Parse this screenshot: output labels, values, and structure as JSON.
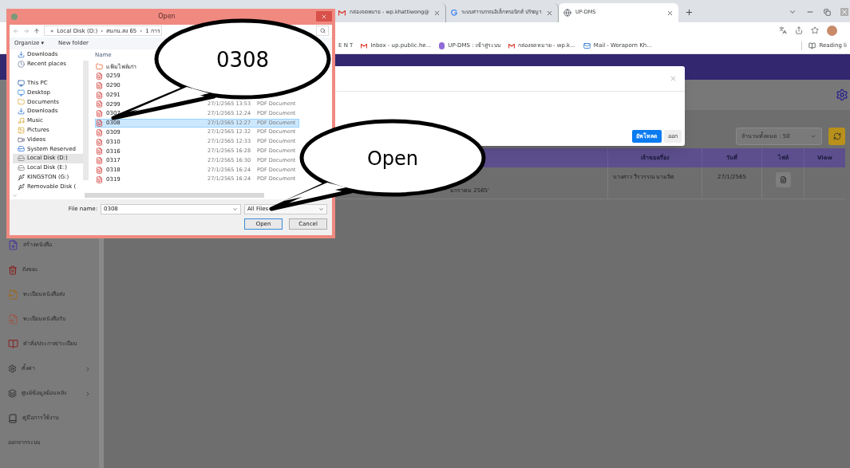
{
  "browser": {
    "tabs": [
      {
        "title": "กล่องจดหมาย - wp.khattiwong@",
        "kind": "gmail",
        "selected": false
      },
      {
        "title": "ระบบสารบรรณอิเล็กทรอนิกส์ ปรัชญา",
        "kind": "google",
        "selected": false
      },
      {
        "title": "UP-DMS",
        "kind": "globe",
        "selected": true
      }
    ],
    "bookmarks": [
      {
        "label": "E N T",
        "kind": "none"
      },
      {
        "label": "Inbox - up.public.he...",
        "kind": "gmail"
      },
      {
        "label": "UP-DMS : เข้าสู่ระบบ",
        "kind": "badge"
      },
      {
        "label": "กล่องจดหมาย - wp.k...",
        "kind": "gmail"
      },
      {
        "label": "Mail - Woraporn Kh...",
        "kind": "outlook"
      }
    ],
    "reading_list": "Reading li"
  },
  "sidebar": {
    "items": [
      {
        "label": "สร้างหนังสือ",
        "kind": "create",
        "submenu": false
      },
      {
        "label": "ถังขยะ",
        "kind": "trash",
        "submenu": false
      },
      {
        "label": "ทะเบียนหนังสือส่ง",
        "kind": "send",
        "submenu": false
      },
      {
        "label": "ทะเบียนหนังสือรับ",
        "kind": "receive",
        "submenu": false
      },
      {
        "label": "คำสั่ง/ประกาศ/ระเบียบ",
        "kind": "book",
        "submenu": false
      },
      {
        "label": "ตั้งค่า",
        "kind": "gear",
        "submenu": true
      },
      {
        "label": "ศูนย์ข้อมูลย้อนหลัง",
        "kind": "layers",
        "submenu": true
      },
      {
        "label": "คู่มือการใช้งาน",
        "kind": "manual",
        "submenu": false
      },
      {
        "label": "ออกจากระบบ",
        "kind": "none",
        "submenu": false
      }
    ]
  },
  "upload_modal": {
    "buttons": [
      {
        "label": "อัพโหลด",
        "kind": "primary"
      },
      {
        "label": "ออก",
        "kind": "secondary"
      }
    ]
  },
  "count_select": {
    "value": "จำนวนทั้งหมด : 50"
  },
  "table": {
    "columns": [
      "เจ้าของเรื่อง",
      "วันที่",
      "ไฟล์",
      "View"
    ],
    "rows": [
      {
        "subject": "มกราคม 2565'",
        "owner": "นางสาว วีรวรรณ นามจิต",
        "date": "27/1/2565"
      }
    ]
  },
  "open_dialog": {
    "title": "Open",
    "breadcrumb": [
      "«",
      "Local Disk (D:)",
      "›",
      "สนกน.สง 65",
      "›",
      "1 การ"
    ],
    "toolbar": [
      "Organize ▾",
      "New folder"
    ],
    "nav": [
      {
        "label": "Downloads",
        "kind": "downloads",
        "selected": false
      },
      {
        "label": "Recent places",
        "kind": "recent",
        "selected": false
      },
      {
        "label": "This PC",
        "kind": "pc",
        "selected": false
      },
      {
        "label": "Desktop",
        "kind": "desktop",
        "selected": false
      },
      {
        "label": "Documents",
        "kind": "documents",
        "selected": false
      },
      {
        "label": "Downloads",
        "kind": "downloads",
        "selected": false
      },
      {
        "label": "Music",
        "kind": "music",
        "selected": false
      },
      {
        "label": "Pictures",
        "kind": "pictures",
        "selected": false
      },
      {
        "label": "Videos",
        "kind": "videos",
        "selected": false
      },
      {
        "label": "System Reserved",
        "kind": "system",
        "selected": false
      },
      {
        "label": "Local Disk (D:)",
        "kind": "drive",
        "selected": true
      },
      {
        "label": "Local Disk (E:)",
        "kind": "drive",
        "selected": false
      },
      {
        "label": "KINGSTON (G:)",
        "kind": "usb",
        "selected": false
      },
      {
        "label": "Removable Disk (",
        "kind": "usb",
        "selected": false
      }
    ],
    "name_column": "Name",
    "files": [
      {
        "name": "แฟ้มไฟล์เก่า",
        "kind": "shortcut",
        "selected": false
      },
      {
        "name": "0259",
        "kind": "pdf",
        "selected": false
      },
      {
        "name": "0290",
        "kind": "pdf",
        "selected": false
      },
      {
        "name": "0291",
        "kind": "pdf",
        "selected": false
      },
      {
        "name": "0299",
        "kind": "pdf",
        "date": "27/1/2565 13:53",
        "type": "PDF Document",
        "selected": false
      },
      {
        "name": "0307",
        "kind": "pdf",
        "date": "27/1/2565 12:24",
        "type": "PDF Document",
        "selected": false
      },
      {
        "name": "0308",
        "kind": "pdf",
        "date": "27/1/2565 12:27",
        "type": "PDF Document",
        "selected": true
      },
      {
        "name": "0309",
        "kind": "pdf",
        "date": "27/1/2565 12:32",
        "type": "PDF Document",
        "selected": false
      },
      {
        "name": "0310",
        "kind": "pdf",
        "date": "27/1/2565 12:33",
        "type": "PDF Document",
        "selected": false
      },
      {
        "name": "0316",
        "kind": "pdf",
        "date": "27/1/2565 16:28",
        "type": "PDF Document",
        "selected": false
      },
      {
        "name": "0317",
        "kind": "pdf",
        "date": "27/1/2565 16:30",
        "type": "PDF Document",
        "selected": false
      },
      {
        "name": "0318",
        "kind": "pdf",
        "date": "27/1/2565 16:24",
        "type": "PDF Document",
        "selected": false
      },
      {
        "name": "0319",
        "kind": "pdf",
        "date": "27/1/2565 16:24",
        "type": "PDF Document",
        "selected": false
      }
    ],
    "file_name_label": "File name:",
    "file_name": "0308",
    "filter": "All Files",
    "buttons": [
      "Open",
      "Cancel"
    ]
  },
  "callouts": [
    {
      "text": "0308"
    },
    {
      "text": "Open"
    }
  ]
}
